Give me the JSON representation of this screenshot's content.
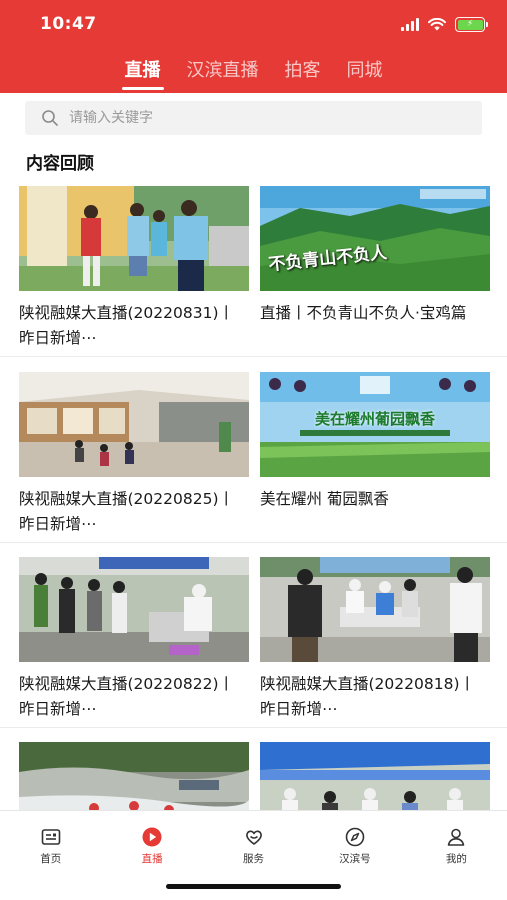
{
  "status_bar": {
    "time": "10:47"
  },
  "top_tabs": [
    {
      "label": "直播",
      "active": true
    },
    {
      "label": "汉滨直播",
      "active": false
    },
    {
      "label": "拍客",
      "active": false
    },
    {
      "label": "同城",
      "active": false
    }
  ],
  "search": {
    "placeholder": "请输入关键字",
    "value": ""
  },
  "section": {
    "title": "内容回顾"
  },
  "cards": [
    {
      "title": "陕视融媒大直播(20220831)丨昨日新增⋯",
      "thumb": "outdoor-volunteers"
    },
    {
      "title": "直播丨不负青山不负人·宝鸡篇",
      "thumb": "green-mountains",
      "thumb_text": "不负青山不负人"
    },
    {
      "title": "陕视融媒大直播(20220825)丨昨日新增⋯",
      "thumb": "mall-interior"
    },
    {
      "title": "美在耀州 葡园飘香",
      "thumb": "vineyard",
      "thumb_text": "美在耀州葡园飘香"
    },
    {
      "title": "陕视融媒大直播(20220822)丨昨日新增⋯",
      "thumb": "testing-site"
    },
    {
      "title": "陕视融媒大直播(20220818)丨 昨日新增⋯",
      "thumb": "testing-crowd"
    },
    {
      "title": "",
      "thumb": "river-rescue"
    },
    {
      "title": "",
      "thumb": "tent-queue"
    }
  ],
  "bottom_nav": [
    {
      "label": "首页",
      "icon": "home-icon",
      "active": false
    },
    {
      "label": "直播",
      "icon": "live-play-icon",
      "active": true
    },
    {
      "label": "服务",
      "icon": "service-heart-icon",
      "active": false
    },
    {
      "label": "汉滨号",
      "icon": "compass-icon",
      "active": false
    },
    {
      "label": "我的",
      "icon": "profile-icon",
      "active": false
    }
  ],
  "colors": {
    "brand_red": "#e53a36",
    "battery_green": "#6cd64c"
  }
}
